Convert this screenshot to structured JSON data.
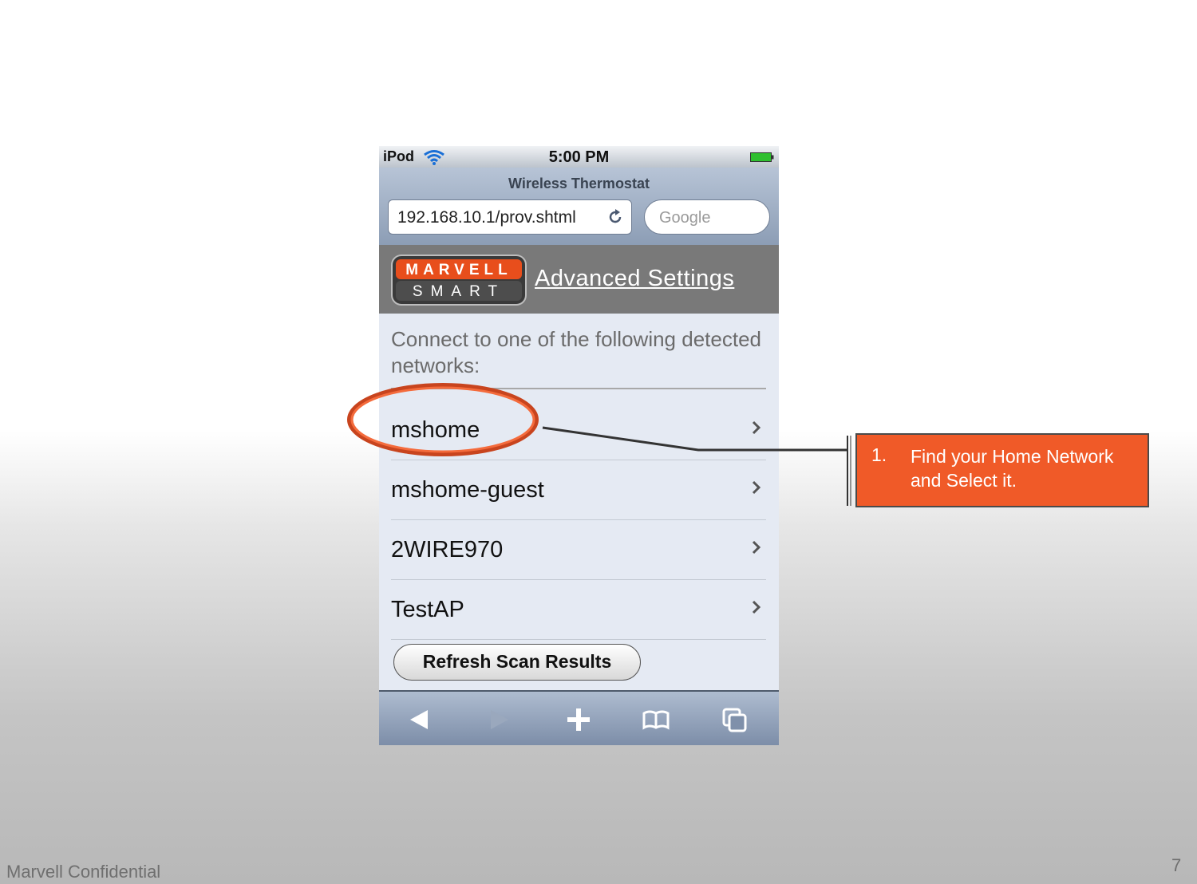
{
  "status_bar": {
    "carrier": "iPod",
    "time": "5:00 PM"
  },
  "browser": {
    "page_title": "Wireless Thermostat",
    "url": "192.168.10.1/prov.shtml",
    "search_placeholder": "Google"
  },
  "header": {
    "logo_top": "MARVELL",
    "logo_bottom": "SMART",
    "advanced_settings_link": "Advanced Settings"
  },
  "intro_text": "Connect to one of the following detected networks:",
  "networks": [
    {
      "name": "mshome"
    },
    {
      "name": "mshome-guest"
    },
    {
      "name": "2WIRE970"
    },
    {
      "name": "TestAP"
    }
  ],
  "refresh_button_label": "Refresh Scan Results",
  "toolbar_icons": [
    "back-icon",
    "forward-icon",
    "add-bookmark-icon",
    "bookmarks-icon",
    "pages-icon"
  ],
  "callout": {
    "number": "1.",
    "text": "Find your Home Network and Select it."
  },
  "footer": {
    "confidential": "Marvell Confidential",
    "page_number": "7"
  },
  "colors": {
    "callout": "#f05a28",
    "highlight_oval": "#e8532a",
    "header_bg": "#797979"
  }
}
